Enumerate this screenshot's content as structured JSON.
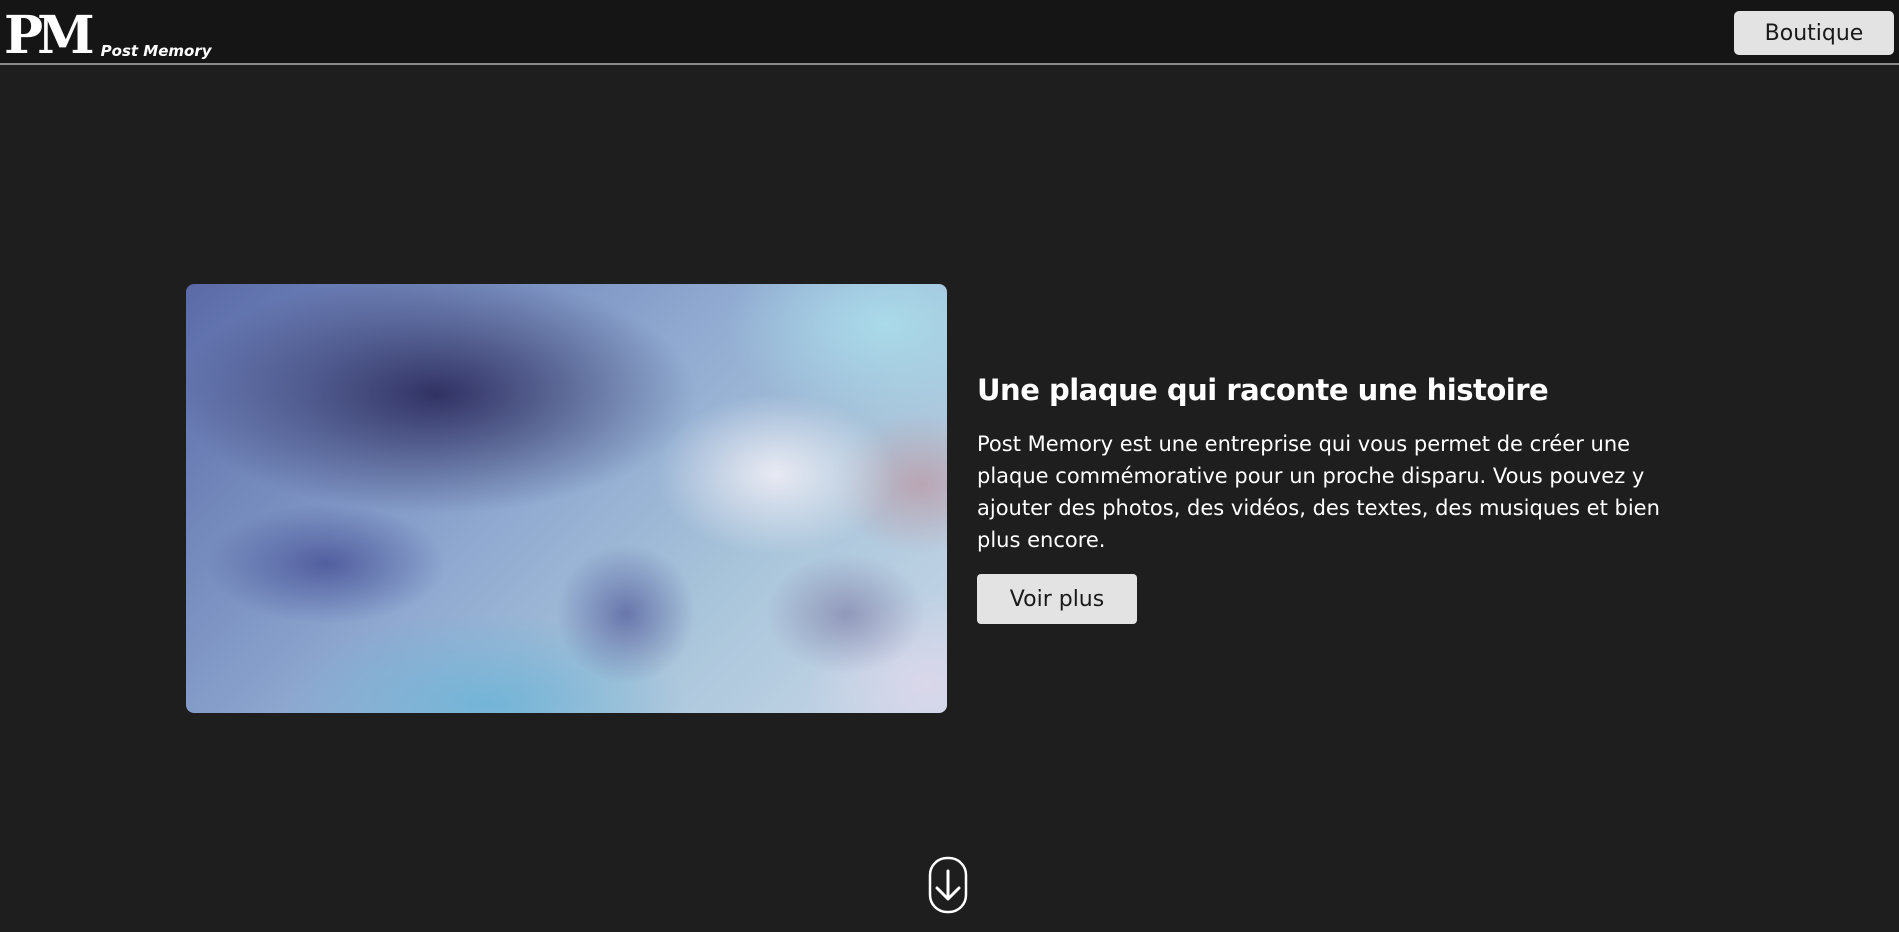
{
  "header": {
    "logo_mark": "PM",
    "logo_text": "Post Memory",
    "boutique_label": "Boutique"
  },
  "hero": {
    "title": "Une plaque qui raconte une histoire",
    "description": "Post Memory est une entreprise qui vous permet de créer une plaque commémorative pour un proche disparu. Vous pouvez y ajouter des photos, des vidéos, des textes, des musiques et bien plus encore.",
    "button_label": "Voir plus"
  },
  "icons": {
    "scroll": "arrow-down-circle-icon"
  },
  "colors": {
    "background": "#1e1e1e",
    "topbar": "#151516",
    "button": "#e3e3e3",
    "text": "#ffffff"
  }
}
